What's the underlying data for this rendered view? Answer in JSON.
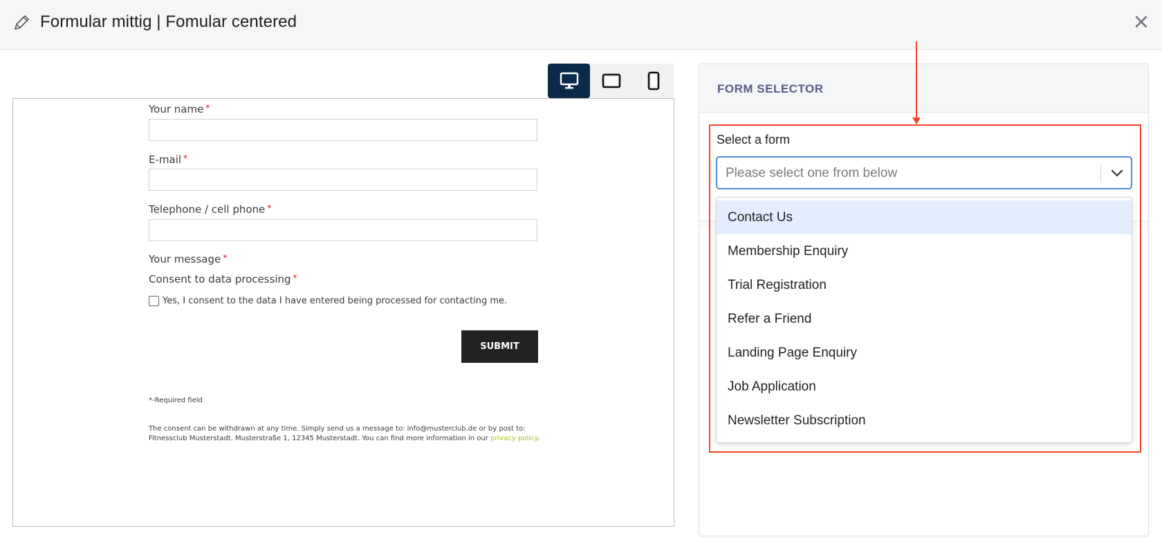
{
  "header": {
    "title": "Formular  mittig | Fomular centered",
    "close_glyph": "×",
    "icons": [
      "pencil-icon",
      "close-icon"
    ]
  },
  "devices": [
    {
      "name": "desktop",
      "icon": "desktop-icon",
      "active": true
    },
    {
      "name": "tablet",
      "icon": "tablet-icon",
      "active": false
    },
    {
      "name": "phone",
      "icon": "phone-icon",
      "active": false
    }
  ],
  "preview_form": {
    "fields": [
      {
        "label": "Your name",
        "required_mark": "*"
      },
      {
        "label": "E-mail",
        "required_mark": "*"
      },
      {
        "label": "Telephone / cell phone",
        "required_mark": "*"
      }
    ],
    "message_label": "Your message",
    "message_required": "*",
    "consent_label": "Consent to data processing",
    "consent_required": "*",
    "consent_checkbox_text": "Yes, I consent to the data I have entered being processed for contacting me.",
    "submit_label": "SUBMIT",
    "required_note": "*-Required field",
    "withdraw_text": "The consent can be withdrawn at any time. Simply send us a message to: info@musterclub.de or by post to: Fitnessclub Musterstadt. Musterstraße 1, 12345 Musterstadt. You can find more information in our",
    "privacy_link": "privacy policy",
    "period": "."
  },
  "selector": {
    "panel_title": "FORM SELECTOR",
    "label": "Select a form",
    "placeholder": "Please select one from below",
    "options": [
      "Contact Us",
      "Membership Enquiry",
      "Trial Registration",
      "Refer a Friend",
      "Landing Page Enquiry",
      "Job Application",
      "Newsletter Subscription"
    ],
    "highlighted_option": "Contact Us"
  },
  "colors": {
    "accent_active_device": "#0b2a4a",
    "select_border": "#4b8fe0",
    "option_highlight": "#e3edfd",
    "annotation": "#ef4423",
    "link": "#a4c21a",
    "required": "#dd1111"
  }
}
